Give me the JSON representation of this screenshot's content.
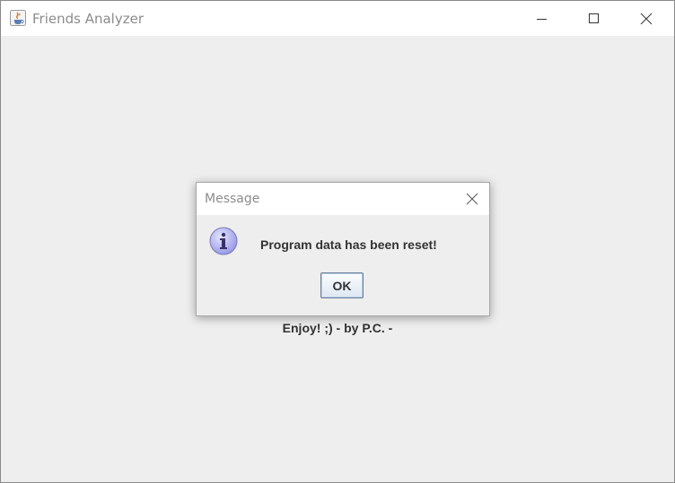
{
  "window": {
    "title": "Friends Analyzer",
    "icon": "java-app-icon",
    "controls": [
      "minimize-icon",
      "maximize-icon",
      "close-icon"
    ]
  },
  "main": {
    "footer_text": "Enjoy! ;) - by P.C. -"
  },
  "dialog": {
    "title": "Message",
    "icon": "info-icon",
    "message": "Program data has been reset!",
    "ok_label": "OK"
  },
  "colors": {
    "content_bg": "#eeeeee",
    "titlebar_bg": "#ffffff",
    "title_text": "#8c8c8c",
    "body_text": "#333333",
    "info_icon": "#9a9ae6"
  }
}
